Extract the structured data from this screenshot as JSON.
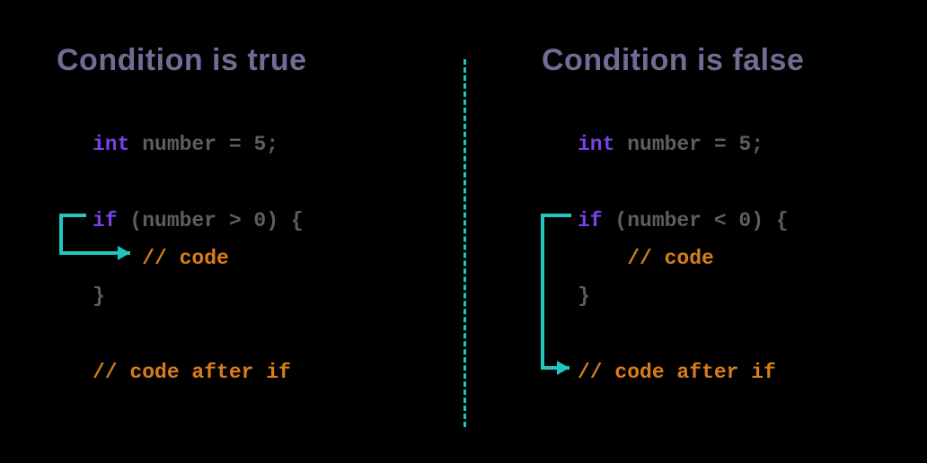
{
  "colors": {
    "keyword": "#7a41ea",
    "identifier": "#5e5e5e",
    "comment": "#d97d1a",
    "title": "#6f6d94",
    "arrow": "#1fc7c0",
    "bg": "#000"
  },
  "left": {
    "title": "Condition is true",
    "lines": {
      "l1_kw": "int",
      "l1_rest": " number = 5;",
      "l2_kw": "if",
      "l2_rest": " (number > 0) {",
      "l3_indent": "    ",
      "l3_comment": "// code",
      "l4": "}",
      "l5_comment": "// code after if"
    }
  },
  "right": {
    "title": "Condition is false",
    "lines": {
      "l1_kw": "int",
      "l1_rest": " number = 5;",
      "l2_kw": "if",
      "l2_rest": " (number < 0) {",
      "l3_indent": "    ",
      "l3_comment": "// code",
      "l4": "}",
      "l5_comment": "// code after if"
    }
  }
}
